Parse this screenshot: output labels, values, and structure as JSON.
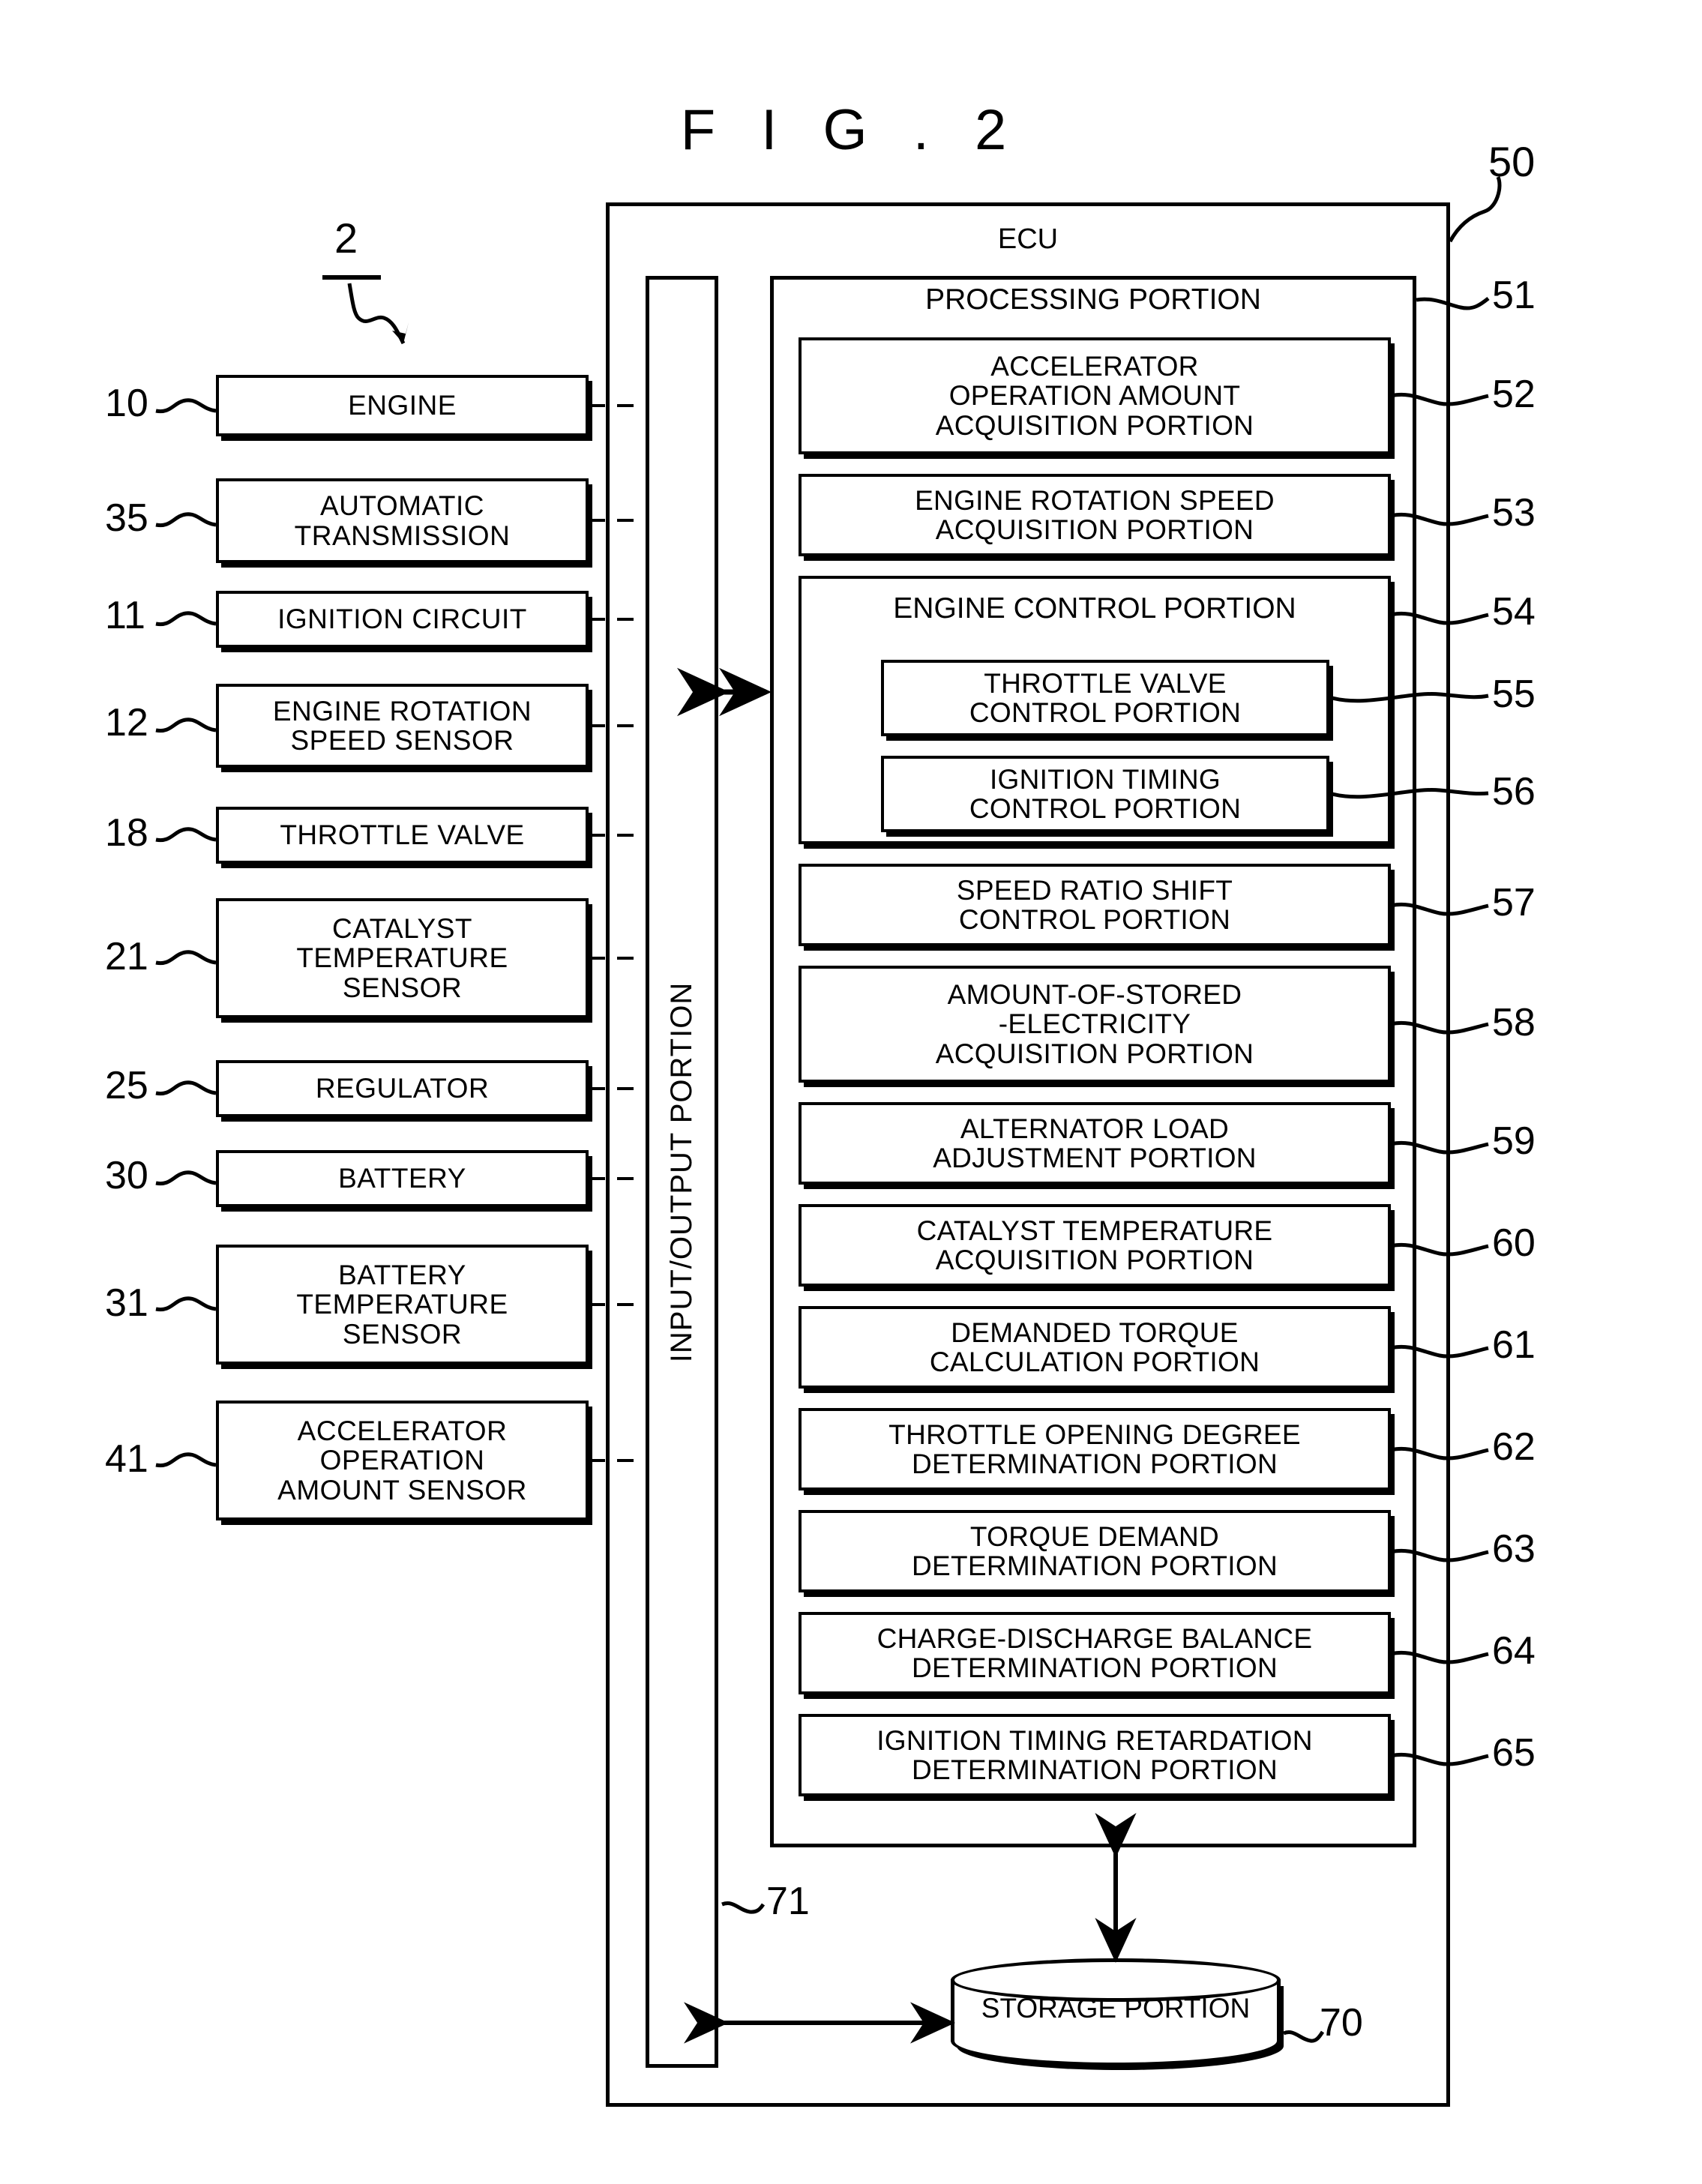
{
  "figure": {
    "title": "F I G . 2",
    "system_ref": "2"
  },
  "ecu": {
    "label": "ECU",
    "ref": "50",
    "io_portion": {
      "label": "INPUT/OUTPUT PORTION",
      "ref": "71"
    },
    "processing_portion": {
      "label": "PROCESSING PORTION",
      "ref": "51"
    },
    "storage_portion": {
      "label": "STORAGE PORTION",
      "ref": "70"
    }
  },
  "external_components": [
    {
      "ref": "10",
      "label": "ENGINE"
    },
    {
      "ref": "35",
      "label": "AUTOMATIC\nTRANSMISSION"
    },
    {
      "ref": "11",
      "label": "IGNITION CIRCUIT"
    },
    {
      "ref": "12",
      "label": "ENGINE ROTATION\nSPEED SENSOR"
    },
    {
      "ref": "18",
      "label": "THROTTLE VALVE"
    },
    {
      "ref": "21",
      "label": "CATALYST\nTEMPERATURE\nSENSOR"
    },
    {
      "ref": "25",
      "label": "REGULATOR"
    },
    {
      "ref": "30",
      "label": "BATTERY"
    },
    {
      "ref": "31",
      "label": "BATTERY\nTEMPERATURE\nSENSOR"
    },
    {
      "ref": "41",
      "label": "ACCELERATOR\nOPERATION\nAMOUNT SENSOR"
    }
  ],
  "processing_blocks": [
    {
      "ref": "52",
      "label": "ACCELERATOR\nOPERATION AMOUNT\nACQUISITION PORTION"
    },
    {
      "ref": "53",
      "label": "ENGINE ROTATION SPEED\nACQUISITION PORTION"
    },
    {
      "ref": "54",
      "label": "ENGINE CONTROL PORTION",
      "children": [
        {
          "ref": "55",
          "label": "THROTTLE VALVE\nCONTROL PORTION"
        },
        {
          "ref": "56",
          "label": "IGNITION TIMING\nCONTROL PORTION"
        }
      ]
    },
    {
      "ref": "57",
      "label": "SPEED RATIO SHIFT\nCONTROL PORTION"
    },
    {
      "ref": "58",
      "label": "AMOUNT-OF-STORED\n-ELECTRICITY\nACQUISITION PORTION"
    },
    {
      "ref": "59",
      "label": "ALTERNATOR LOAD\nADJUSTMENT PORTION"
    },
    {
      "ref": "60",
      "label": "CATALYST TEMPERATURE\nACQUISITION PORTION"
    },
    {
      "ref": "61",
      "label": "DEMANDED TORQUE\nCALCULATION PORTION"
    },
    {
      "ref": "62",
      "label": "THROTTLE OPENING DEGREE\nDETERMINATION PORTION"
    },
    {
      "ref": "63",
      "label": "TORQUE DEMAND\nDETERMINATION PORTION"
    },
    {
      "ref": "64",
      "label": "CHARGE-DISCHARGE BALANCE\nDETERMINATION PORTION"
    },
    {
      "ref": "65",
      "label": "IGNITION TIMING RETARDATION\nDETERMINATION PORTION"
    }
  ]
}
